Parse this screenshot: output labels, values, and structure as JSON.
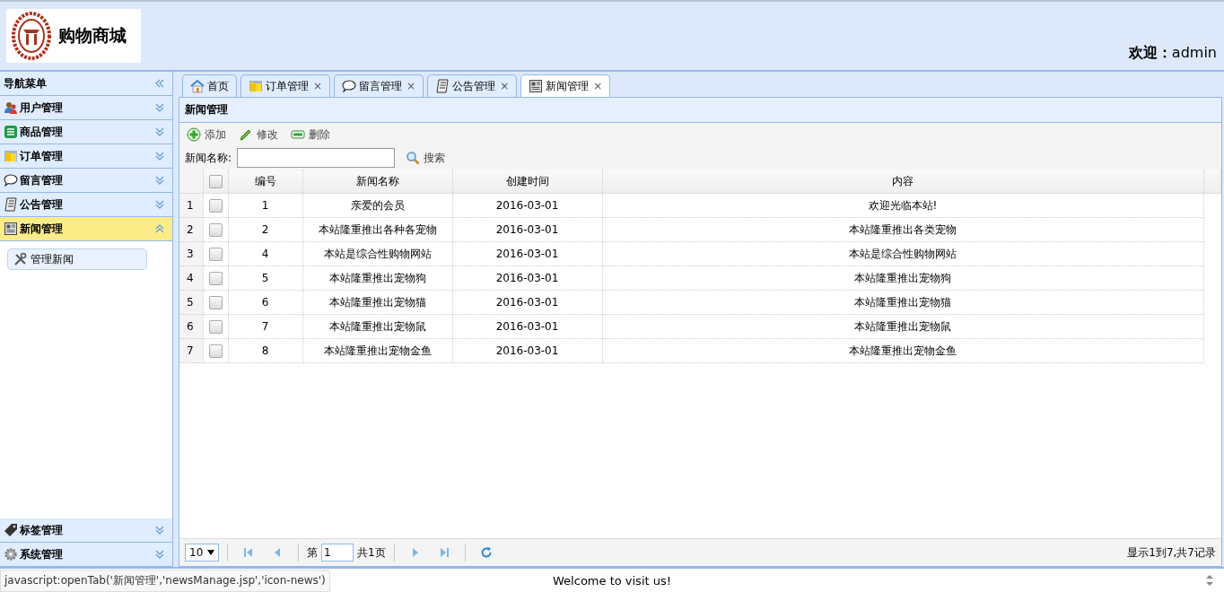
{
  "header": {
    "logo_text": "购物商城",
    "welcome_label": "欢迎：",
    "user": "admin"
  },
  "sidebar": {
    "title": "导航菜单",
    "items": [
      {
        "label": "用户管理",
        "kind": "users",
        "expanded": false
      },
      {
        "label": "商品管理",
        "kind": "list",
        "expanded": false
      },
      {
        "label": "订单管理",
        "kind": "folder",
        "expanded": false
      },
      {
        "label": "留言管理",
        "kind": "chat",
        "expanded": false
      },
      {
        "label": "公告管理",
        "kind": "notice",
        "expanded": false
      },
      {
        "label": "新闻管理",
        "kind": "news",
        "expanded": true,
        "children": [
          {
            "label": "管理新闻",
            "kind": "tools",
            "selected": true
          }
        ]
      },
      {
        "label": "标签管理",
        "kind": "tag",
        "expanded": false
      },
      {
        "label": "系统管理",
        "kind": "gear",
        "expanded": false
      }
    ]
  },
  "tabs": [
    {
      "label": "首页",
      "kind": "home",
      "selected": false
    },
    {
      "label": "订单管理",
      "kind": "folder",
      "close": "×",
      "selected": false
    },
    {
      "label": "留言管理",
      "kind": "chat",
      "close": "×",
      "selected": false
    },
    {
      "label": "公告管理",
      "kind": "notice",
      "close": "×",
      "selected": false
    },
    {
      "label": "新闻管理",
      "kind": "news",
      "close": "×",
      "selected": true
    }
  ],
  "panel": {
    "title": "新闻管理",
    "toolbar": [
      {
        "label": "添加",
        "kind": "plus"
      },
      {
        "label": "修改",
        "kind": "pencil"
      },
      {
        "label": "删除",
        "kind": "minus"
      }
    ],
    "search": {
      "label": "新闻名称:",
      "button": "搜索"
    },
    "table": {
      "columns": [
        "编号",
        "新闻名称",
        "创建时间",
        "内容"
      ],
      "header_checked": false,
      "rows": [
        {
          "n": "1",
          "checked": false,
          "cells": [
            "1",
            "亲爱的会员",
            "2016-03-01",
            "欢迎光临本站!"
          ]
        },
        {
          "n": "2",
          "checked": false,
          "cells": [
            "2",
            "本站隆重推出各种各宠物",
            "2016-03-01",
            "本站隆重推出各类宠物"
          ]
        },
        {
          "n": "3",
          "checked": false,
          "cells": [
            "4",
            "本站是综合性购物网站",
            "2016-03-01",
            "本站是综合性购物网站"
          ]
        },
        {
          "n": "4",
          "checked": false,
          "cells": [
            "5",
            "本站隆重推出宠物狗",
            "2016-03-01",
            "本站隆重推出宠物狗"
          ]
        },
        {
          "n": "5",
          "checked": false,
          "cells": [
            "6",
            "本站隆重推出宠物猫",
            "2016-03-01",
            "本站隆重推出宠物猫"
          ]
        },
        {
          "n": "6",
          "checked": false,
          "cells": [
            "7",
            "本站隆重推出宠物鼠",
            "2016-03-01",
            "本站隆重推出宠物鼠"
          ]
        },
        {
          "n": "7",
          "checked": false,
          "cells": [
            "8",
            "本站隆重推出宠物金鱼",
            "2016-03-01",
            "本站隆重推出宠物金鱼"
          ]
        }
      ]
    },
    "pager": {
      "page_size": "10",
      "page_prefix": "第",
      "page": "1",
      "page_total": "共1页",
      "summary": "显示1到7,共7记录"
    }
  },
  "footer": {
    "welcome": "Welcome to visit us!",
    "status_url": "javascript:openTab('新闻管理','newsManage.jsp','icon-news')"
  }
}
